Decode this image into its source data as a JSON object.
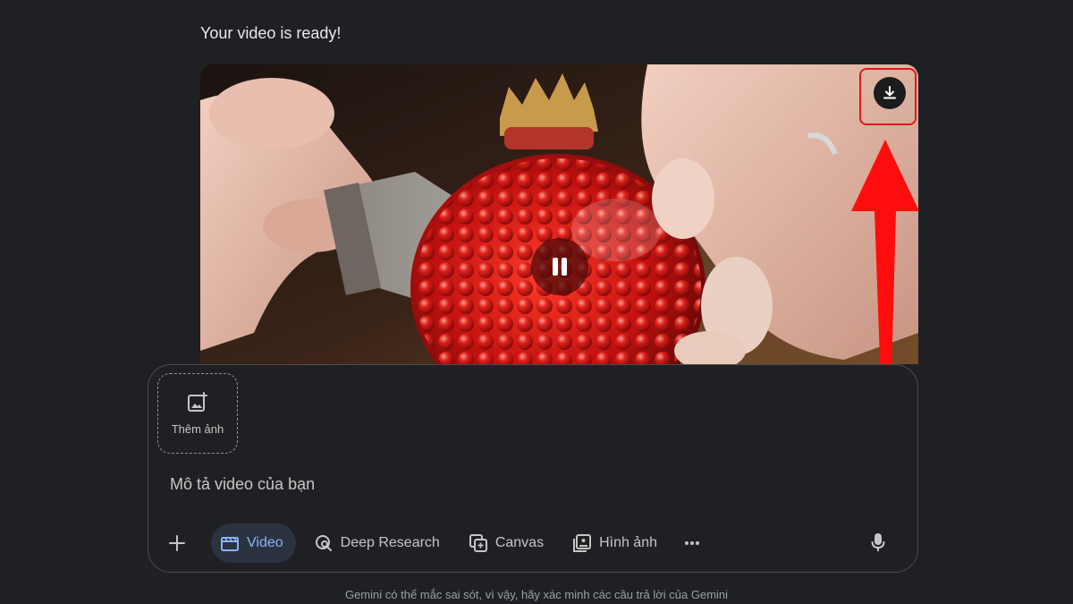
{
  "status_message": "Your video is ready!",
  "video": {
    "download_icon": "download-icon",
    "pause_icon": "pause-icon"
  },
  "composer": {
    "add_image_label": "Thêm ảnh",
    "prompt_placeholder": "Mô tả video của bạn",
    "tools": {
      "video_label": "Video",
      "deep_research_label": "Deep Research",
      "canvas_label": "Canvas",
      "images_label": "Hình ảnh"
    }
  },
  "disclaimer": "Gemini có thể mắc sai sót, vì vậy, hãy xác minh các câu trả lời của Gemini",
  "colors": {
    "background": "#1f2023",
    "accent": "#8ab4f8",
    "highlight": "#e3161b"
  }
}
